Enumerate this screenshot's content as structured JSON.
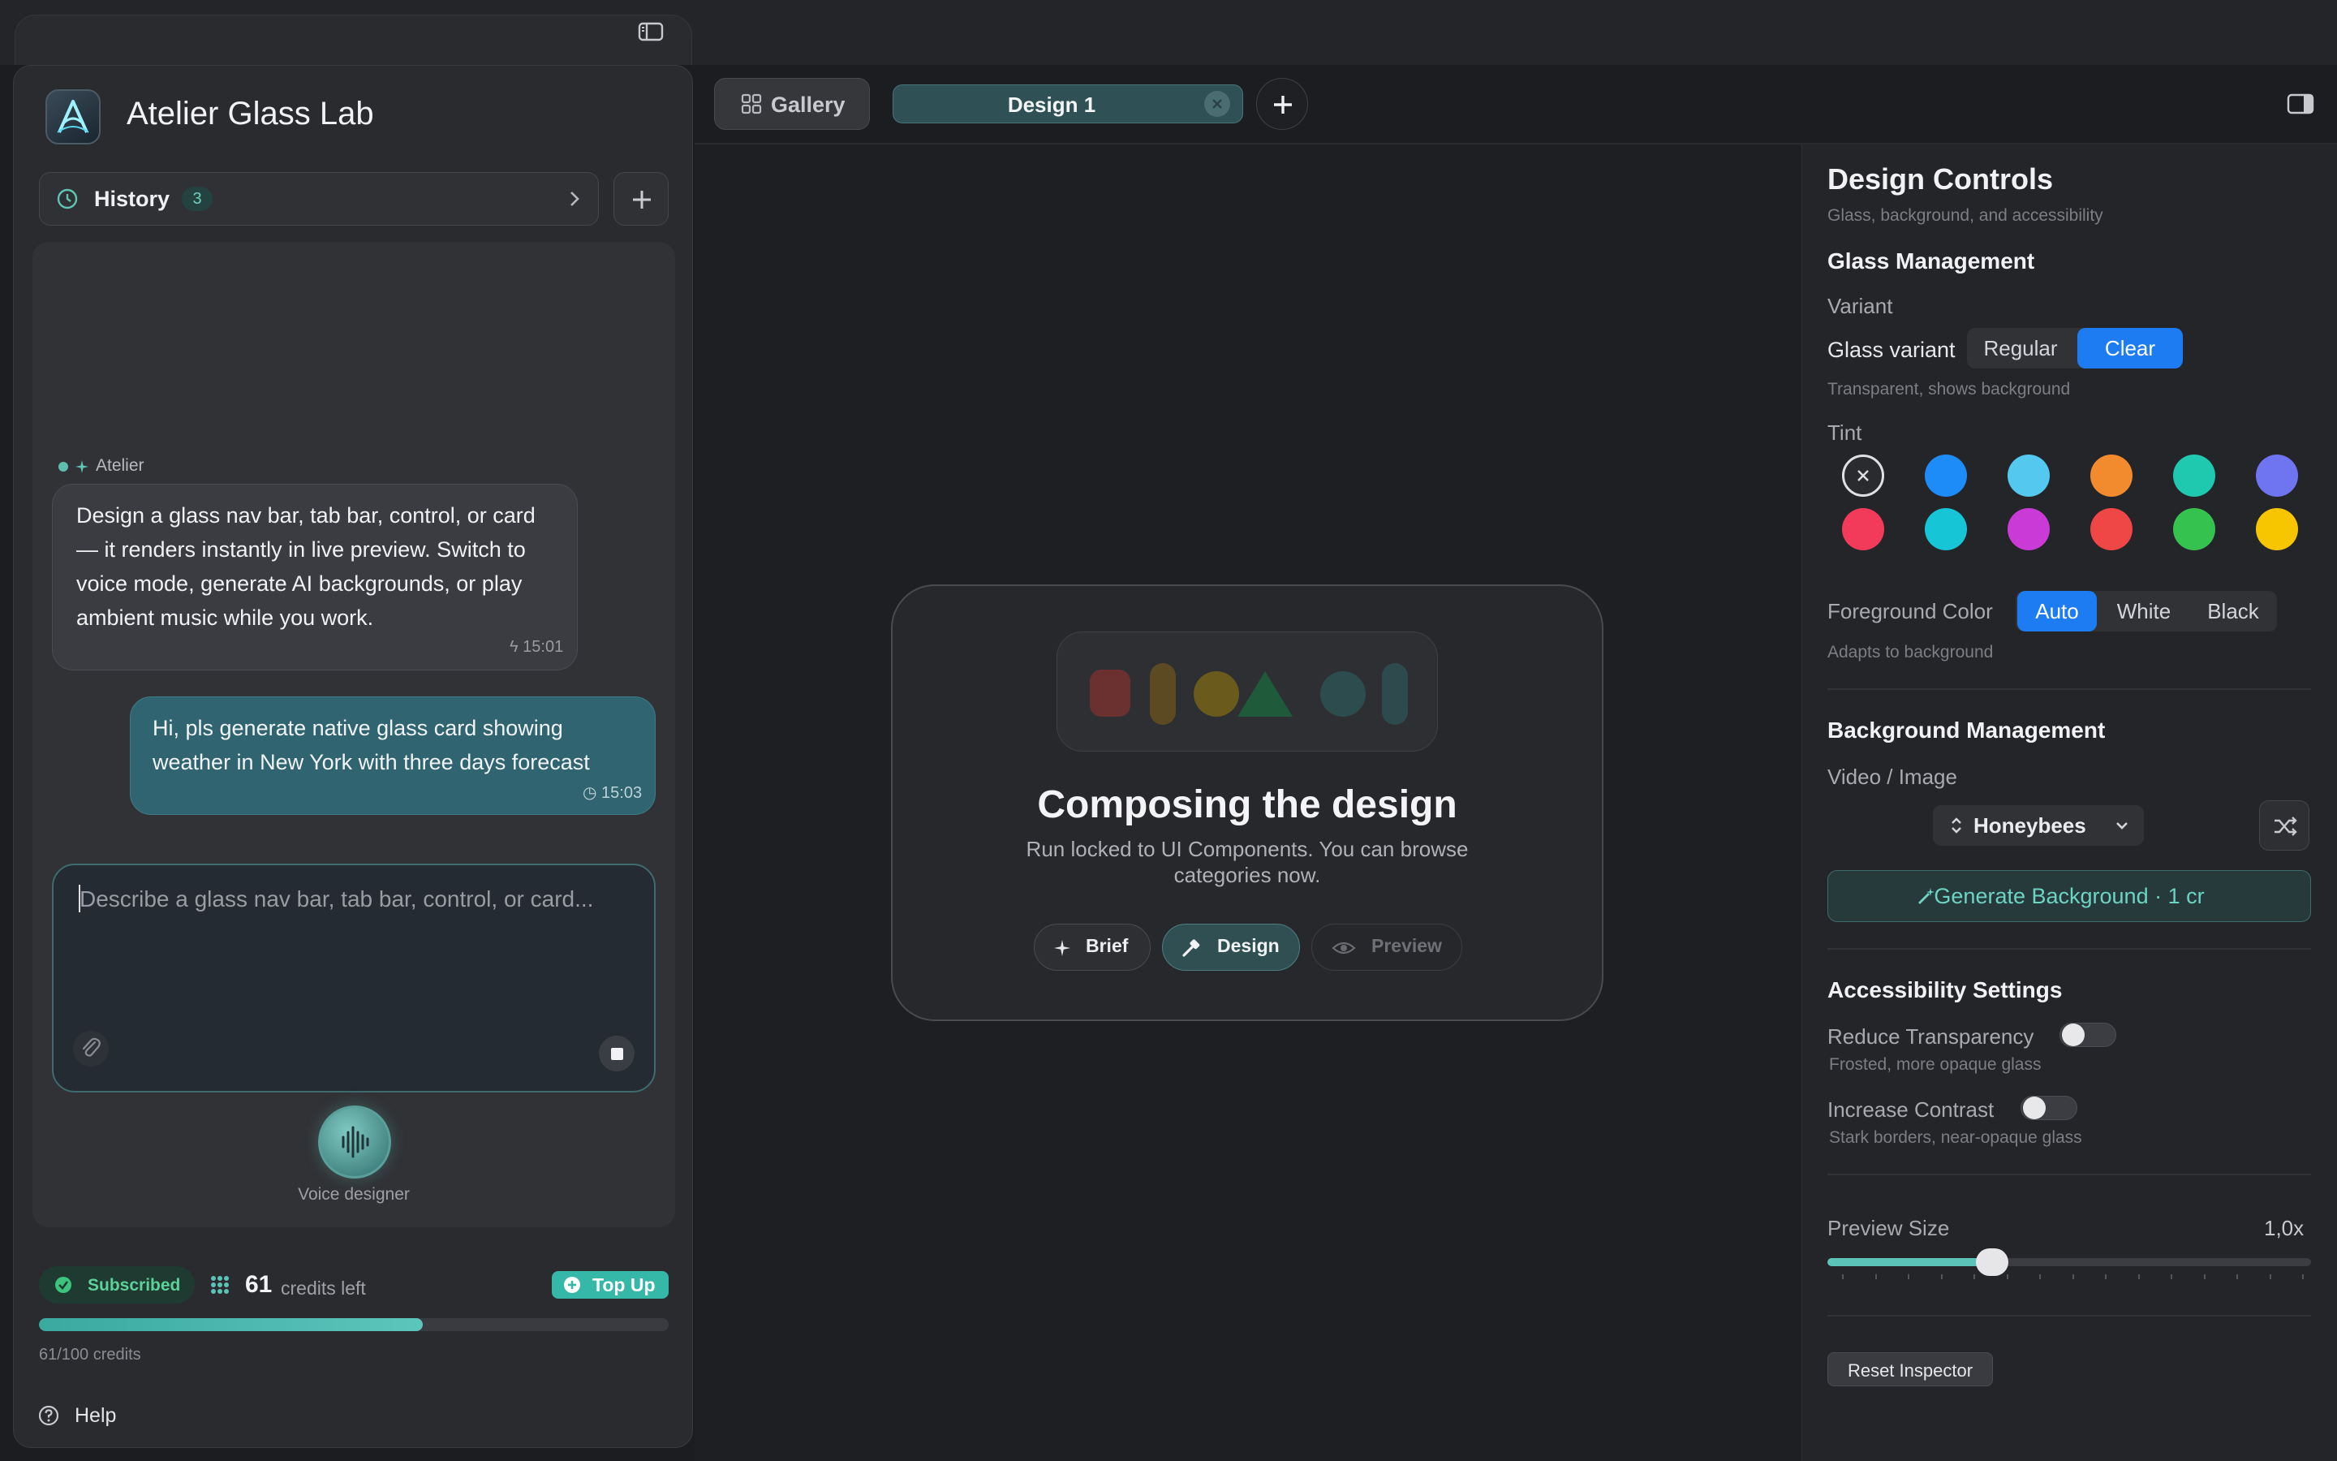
{
  "sidebar": {
    "app_title": "Atelier Glass Lab",
    "history_label": "History",
    "history_count": "3",
    "assistant_name": "Atelier",
    "assistant_message": "Design a glass nav bar, tab bar, control, or card — it renders instantly in live preview. Switch to voice mode, generate AI backgrounds, or play ambient music while you work.",
    "assistant_time": "15:01",
    "user_message": "Hi, pls generate native glass card showing weather in New York with three days forecast",
    "user_time": "15:03",
    "composer_placeholder": "Describe a glass nav bar, tab bar, control, or card...",
    "voice_label": "Voice designer",
    "subscription_status": "Subscribed",
    "credits_number": "61",
    "credits_label": "credits left",
    "topup_label": "Top Up",
    "credits_used": 61,
    "credits_total": 100,
    "credits_detail": "61/100 credits",
    "help_label": "Help"
  },
  "tabs": {
    "gallery_label": "Gallery",
    "active_tab_label": "Design 1"
  },
  "canvas": {
    "title": "Composing the design",
    "subtitle": "Run locked to UI Components. You can browse categories now.",
    "steps": [
      "Brief",
      "Design",
      "Preview"
    ],
    "active_step": "Design",
    "shape_colors": [
      "#6b3030",
      "#5c4a22",
      "#6a5a1c",
      "#1f5a3a",
      "#2d4c4e",
      "#2f4a4c"
    ]
  },
  "inspector": {
    "title": "Design Controls",
    "subtitle": "Glass, background, and accessibility",
    "glass_section": "Glass Management",
    "variant_heading": "Variant",
    "glass_variant_label": "Glass variant",
    "glass_variant_options": [
      "Regular",
      "Clear"
    ],
    "glass_variant_selected": "Clear",
    "variant_hint": "Transparent, shows background",
    "tint_heading": "Tint",
    "tint_colors": [
      "#1e8cf8",
      "#55c8f0",
      "#f28a2e",
      "#1fc9b0",
      "#6f74f0",
      "#f23a5a",
      "#17c6d6",
      "#c93ad6",
      "#ef4646",
      "#35c24e",
      "#f7c600"
    ],
    "foreground_label": "Foreground Color",
    "foreground_options": [
      "Auto",
      "White",
      "Black"
    ],
    "foreground_selected": "Auto",
    "foreground_hint": "Adapts to background",
    "background_section": "Background Management",
    "video_image_label": "Video / Image",
    "background_selected": "Honeybees",
    "generate_bg_label": "Generate Background · 1 cr",
    "accessibility_section": "Accessibility Settings",
    "reduce_transparency_label": "Reduce Transparency",
    "reduce_transparency_hint": "Frosted, more opaque glass",
    "reduce_transparency_on": false,
    "increase_contrast_label": "Increase Contrast",
    "increase_contrast_hint": "Stark borders, near-opaque glass",
    "increase_contrast_on": false,
    "preview_size_label": "Preview Size",
    "preview_size_value": "1,0x",
    "preview_size_fraction": 0.34,
    "reset_label": "Reset Inspector"
  },
  "colors": {
    "accent_teal": "#5cc3b9",
    "accent_blue": "#1d7cf2",
    "subscribed_green": "#5ed19a"
  }
}
